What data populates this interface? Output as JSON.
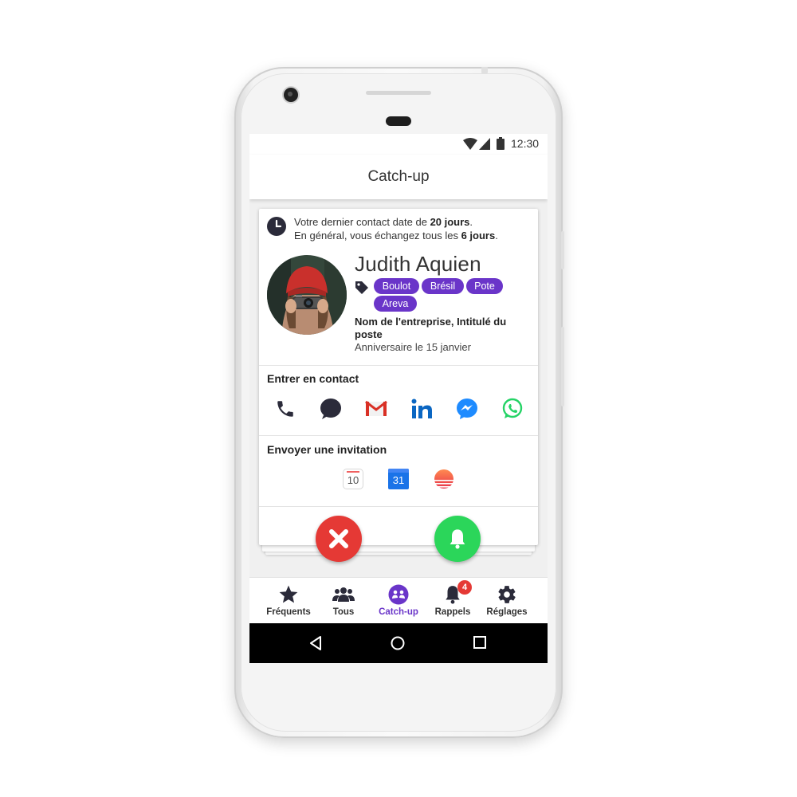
{
  "status_bar": {
    "time": "12:30"
  },
  "app_bar": {
    "title": "Catch-up"
  },
  "card": {
    "last_contact": {
      "line1_prefix": "Votre dernier contact date de ",
      "line1_bold": "20 jours",
      "line1_suffix": ".",
      "line2_prefix": "En général, vous échangez tous les ",
      "line2_bold": "6 jours",
      "line2_suffix": "."
    },
    "contact": {
      "name": "Judith Aquien",
      "tags": [
        "Boulot",
        "Brésil",
        "Pote",
        "Areva"
      ],
      "company": "Nom de l'entreprise, Intitulé du poste",
      "birthday": "Anniversaire le 15 janvier"
    },
    "contact_section": {
      "title": "Entrer en contact",
      "channels": [
        "phone-icon",
        "sms-icon",
        "gmail-icon",
        "linkedin-icon",
        "messenger-icon",
        "whatsapp-icon"
      ]
    },
    "invite_section": {
      "title": "Envoyer une invitation",
      "calendars": [
        {
          "icon": "apple-calendar-icon",
          "day": "10"
        },
        {
          "icon": "google-calendar-icon",
          "day": "31"
        },
        {
          "icon": "sunrise-calendar-icon",
          "day": ""
        }
      ]
    },
    "actions": {
      "dismiss": "close-icon",
      "remind": "bell-icon"
    }
  },
  "bottom_nav": {
    "items": [
      {
        "label": "Fréquents",
        "icon": "star-icon"
      },
      {
        "label": "Tous",
        "icon": "group-icon"
      },
      {
        "label": "Catch-up",
        "icon": "catchup-icon",
        "active": true
      },
      {
        "label": "Rappels",
        "icon": "bell-icon",
        "badge": "4"
      },
      {
        "label": "Réglages",
        "icon": "gear-icon"
      }
    ]
  },
  "colors": {
    "accent": "#6a35c9",
    "dismiss": "#e53935",
    "remind": "#2bd65a",
    "badge": "#e53935",
    "text": "#333333"
  }
}
